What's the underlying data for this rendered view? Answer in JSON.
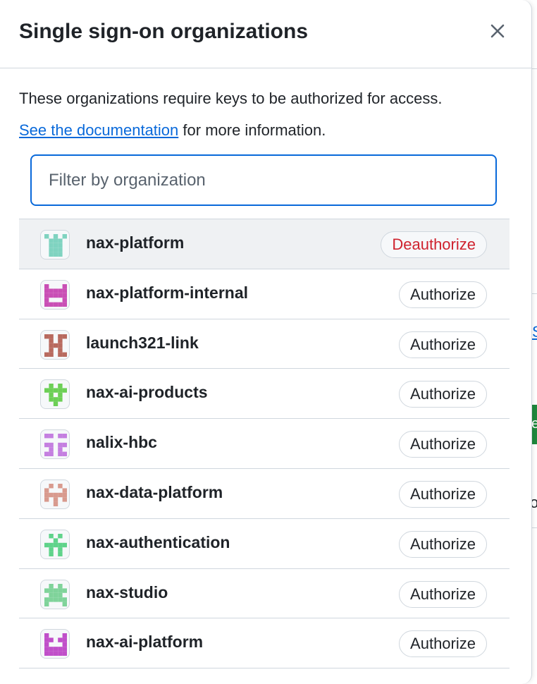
{
  "dialog": {
    "title": "Single sign-on organizations",
    "description": "These organizations require keys to be authorized for access.",
    "doc_link": "See the documentation",
    "doc_suffix": "for more information.",
    "filter_placeholder": "Filter by organization"
  },
  "orgs": [
    {
      "name": "nax-platform",
      "action": "Deauthorize",
      "color": "#7fd3c0",
      "icon": "identicon-avatar"
    },
    {
      "name": "nax-platform-internal",
      "action": "Authorize",
      "color": "#c94fb5",
      "icon": "identicon-avatar"
    },
    {
      "name": "launch321-link",
      "action": "Authorize",
      "color": "#b86a5f",
      "icon": "identicon-avatar"
    },
    {
      "name": "nax-ai-products",
      "action": "Authorize",
      "color": "#6ccf56",
      "icon": "identicon-avatar"
    },
    {
      "name": "nalix-hbc",
      "action": "Authorize",
      "color": "#c47fe0",
      "icon": "identicon-avatar"
    },
    {
      "name": "nax-data-platform",
      "action": "Authorize",
      "color": "#d89a8e",
      "icon": "identicon-avatar"
    },
    {
      "name": "nax-authentication",
      "action": "Authorize",
      "color": "#5fd38a",
      "icon": "identicon-avatar"
    },
    {
      "name": "nax-studio",
      "action": "Authorize",
      "color": "#7fd39a",
      "icon": "identicon-avatar"
    },
    {
      "name": "nax-ai-platform",
      "action": "Authorize",
      "color": "#c04fc9",
      "icon": "identicon-avatar"
    }
  ],
  "background": {
    "link_fragment": "S",
    "button_fragment": "e",
    "text_fragment": "o"
  }
}
